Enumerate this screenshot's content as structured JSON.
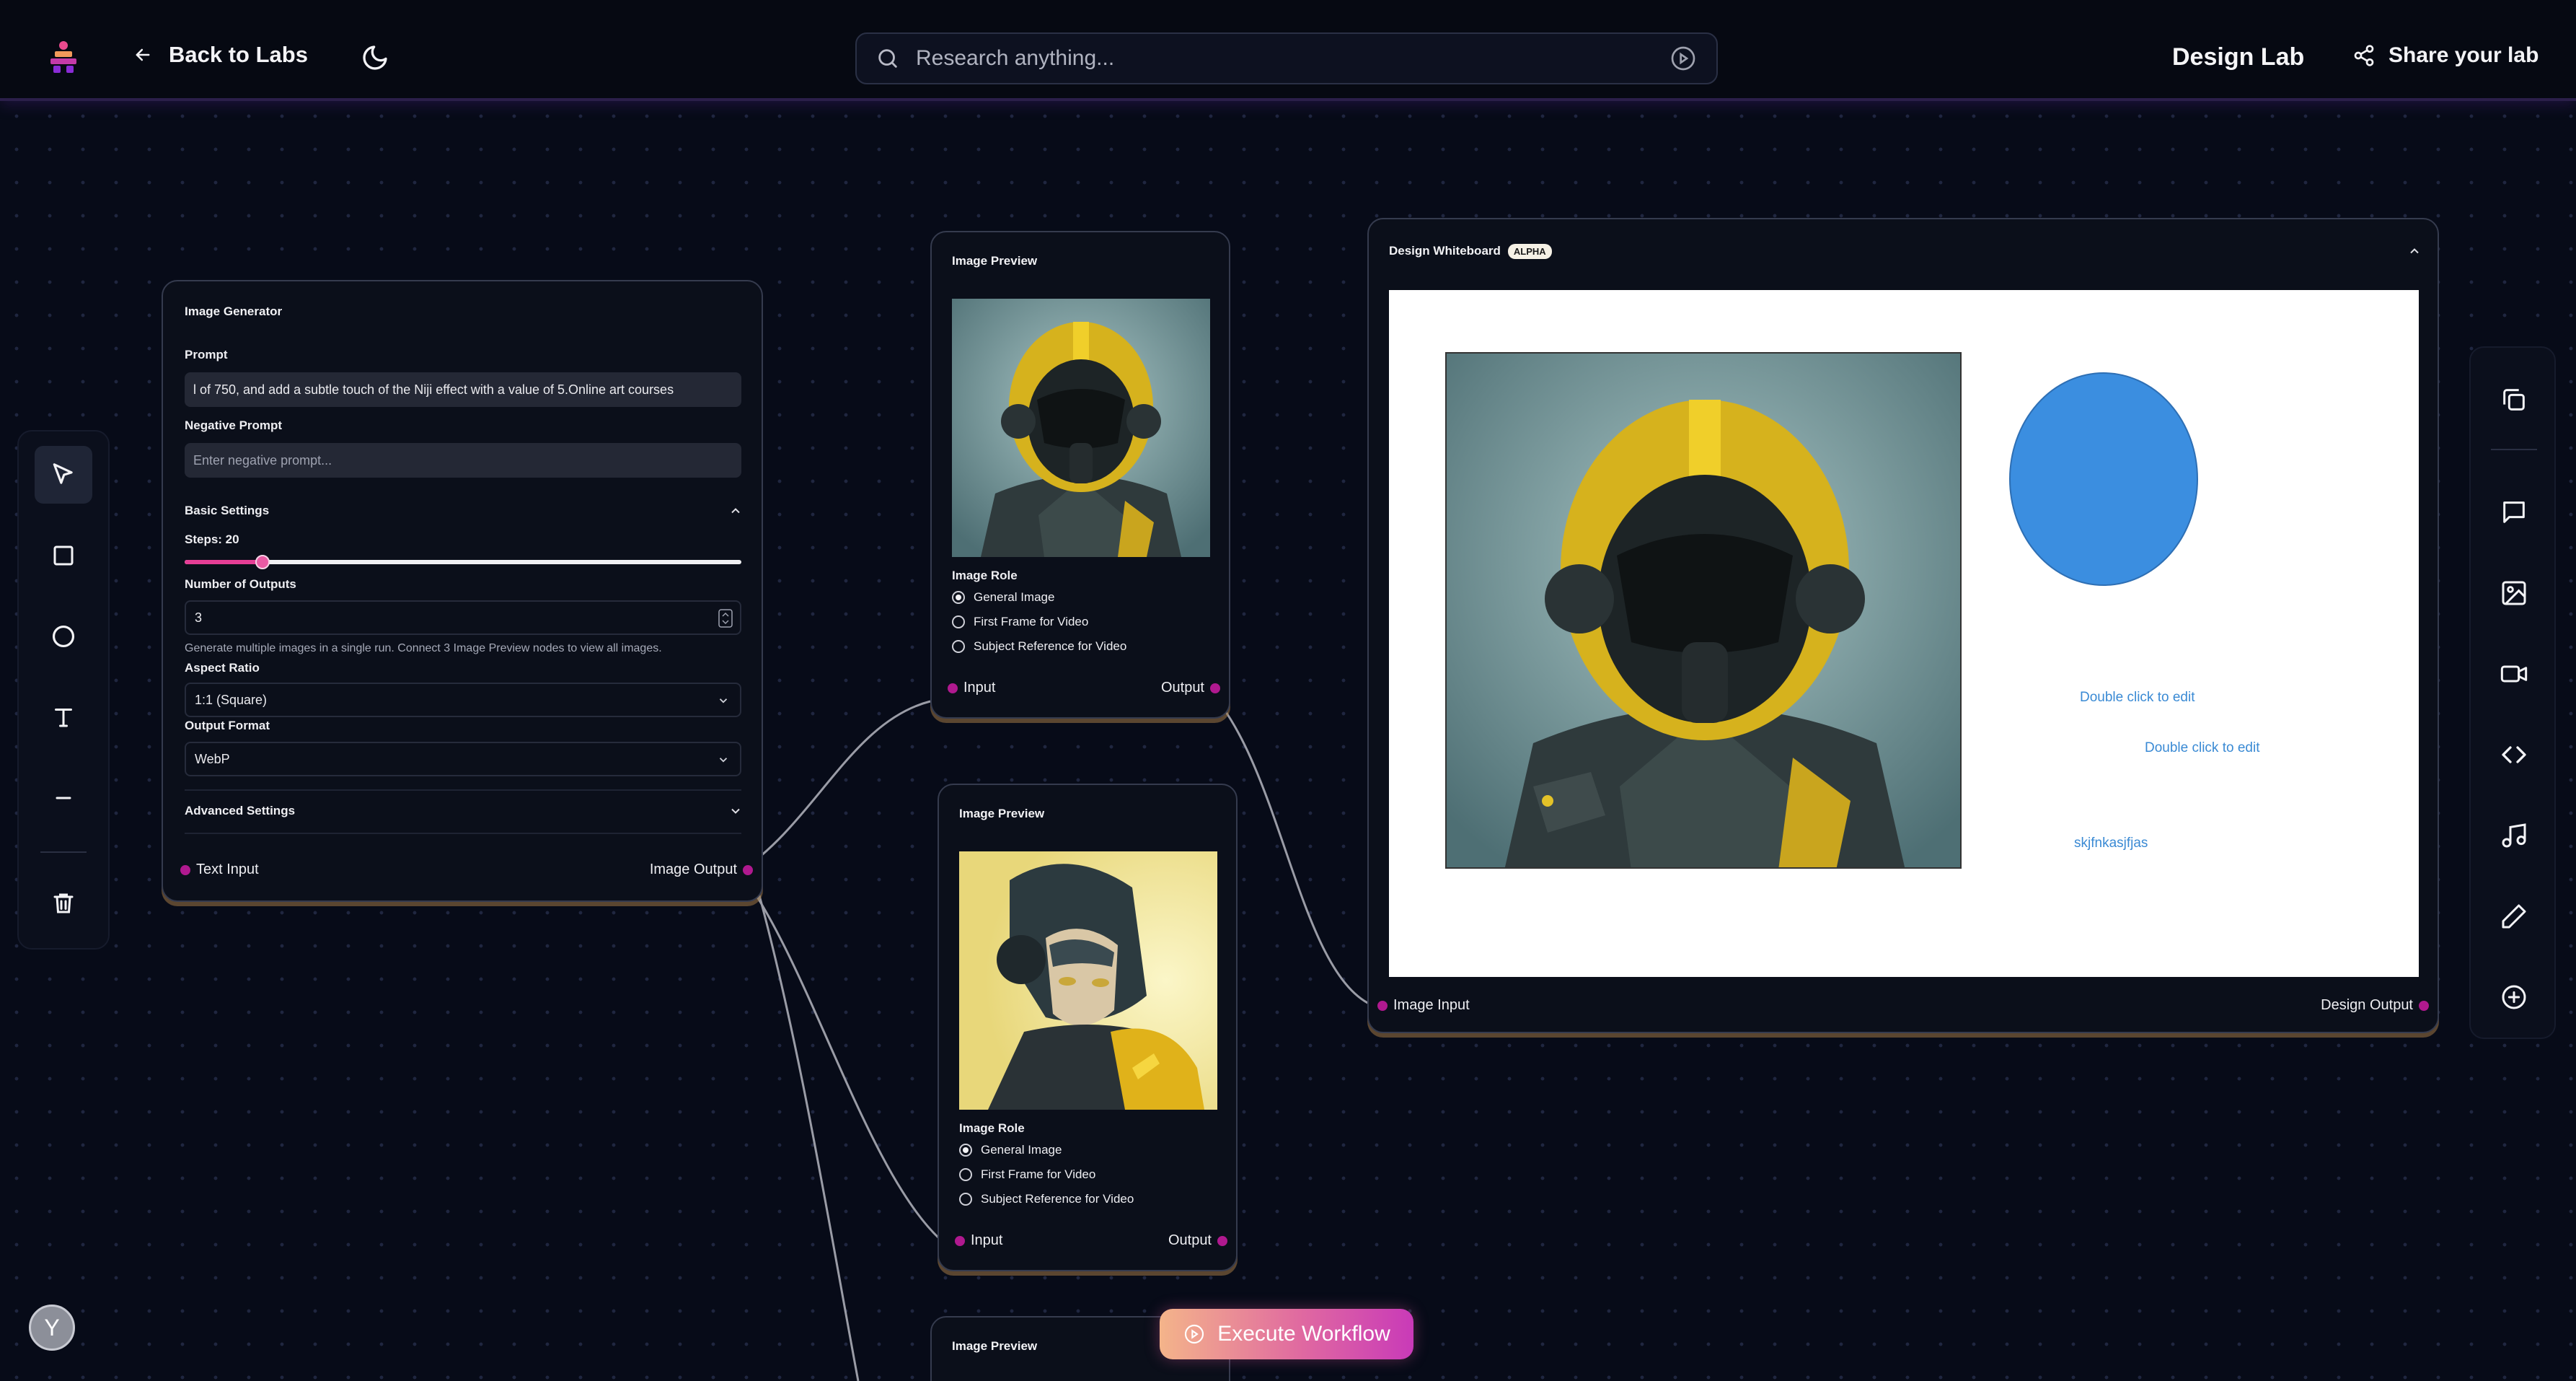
{
  "header": {
    "back_label": "Back to Labs",
    "search_placeholder": "Research anything...",
    "lab_title": "Design Lab",
    "share_label": "Share your lab"
  },
  "image_generator": {
    "title": "Image Generator",
    "prompt_label": "Prompt",
    "prompt_value": "l of 750, and add a subtle touch of the Niji effect with a value of 5.Online art courses",
    "negative_label": "Negative Prompt",
    "negative_placeholder": "Enter negative prompt...",
    "basic_settings_label": "Basic Settings",
    "steps_label": "Steps: 20",
    "steps_fraction": 0.14,
    "outputs_label": "Number of Outputs",
    "outputs_value": "3",
    "outputs_help": "Generate multiple images in a single run. Connect 3 Image Preview nodes to view all images.",
    "aspect_label": "Aspect Ratio",
    "aspect_value": "1:1 (Square)",
    "format_label": "Output Format",
    "format_value": "WebP",
    "advanced_label": "Advanced Settings",
    "input_port": "Text Input",
    "output_port": "Image Output"
  },
  "previews": [
    {
      "title": "Image Preview",
      "role_label": "Image Role",
      "roles": [
        "General Image",
        "First Frame for Video",
        "Subject Reference for Video"
      ],
      "selected_role": 0,
      "input_port": "Input",
      "output_port": "Output"
    },
    {
      "title": "Image Preview",
      "role_label": "Image Role",
      "roles": [
        "General Image",
        "First Frame for Video",
        "Subject Reference for Video"
      ],
      "selected_role": 0,
      "input_port": "Input",
      "output_port": "Output"
    },
    {
      "title": "Image Preview"
    }
  ],
  "whiteboard": {
    "title": "Design Whiteboard",
    "badge": "ALPHA",
    "texts": [
      "Double click to edit",
      "Double click to edit",
      "skjfnkasjfjas"
    ],
    "input_port": "Image Input",
    "output_port": "Design Output"
  },
  "execute_label": "Execute Workflow",
  "avatar_initial": "Y",
  "colors": {
    "accent_pink": "#e63e96",
    "port_magenta": "#b0198f",
    "background": "#070b18"
  }
}
